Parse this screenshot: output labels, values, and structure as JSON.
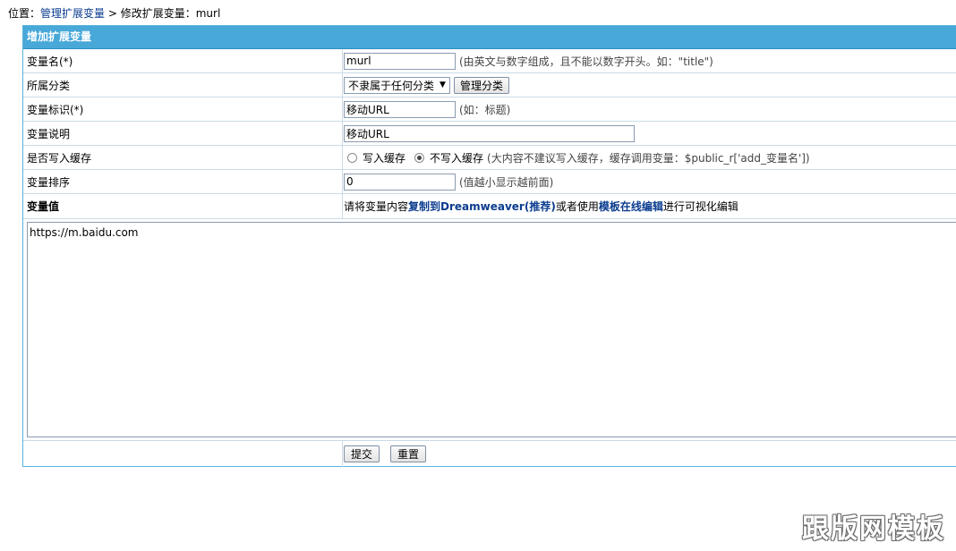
{
  "breadcrumb": {
    "prefix": "位置：",
    "link": "管理扩展变量",
    "sep": " > ",
    "current": "修改扩展变量：murl"
  },
  "form": {
    "title": "增加扩展变量",
    "var_name": {
      "label": "变量名(*)",
      "value": "murl",
      "hint": "(由英文与数字组成，且不能以数字开头。如：\"title\")"
    },
    "category": {
      "label": "所属分类",
      "selected": "不隶属于任何分类",
      "manage_button": "管理分类"
    },
    "var_mark": {
      "label": "变量标识(*)",
      "value": "移动URL",
      "hint": "(如：标题)"
    },
    "var_desc": {
      "label": "变量说明",
      "value": "移动URL"
    },
    "cache": {
      "label": "是否写入缓存",
      "option_yes": "写入缓存",
      "option_no": "不写入缓存",
      "selected": "option_no",
      "hint": "(大内容不建议写入缓存，缓存调用变量：$public_r['add_变量名'])"
    },
    "order": {
      "label": "变量排序",
      "value": "0",
      "hint": "(值越小显示越前面)"
    },
    "var_value": {
      "label": "变量值",
      "desc_prefix": "请将变量内容",
      "desc_link1": "复制到Dreamweaver(推荐)",
      "desc_middle": "或者使用",
      "desc_link2": "模板在线编辑",
      "desc_suffix": "进行可视化编辑",
      "content": "https://m.baidu.com"
    },
    "submit_label": "提交",
    "reset_label": "重置"
  },
  "watermark": "跟版网模板"
}
